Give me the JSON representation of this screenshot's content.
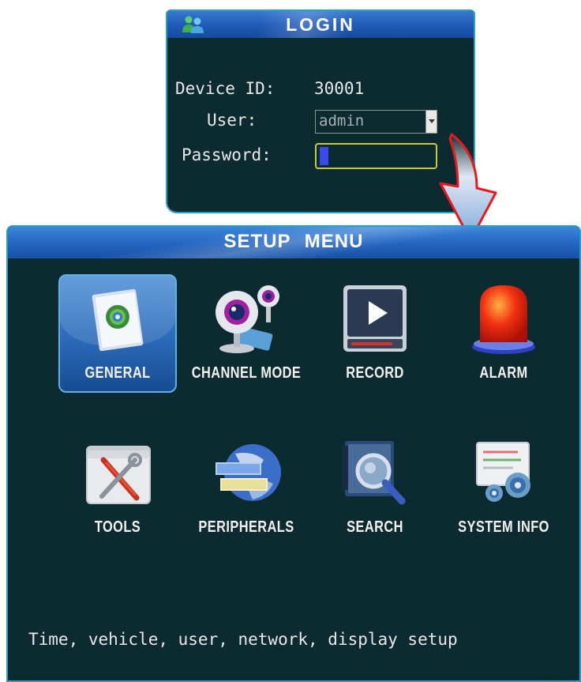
{
  "login": {
    "title": "LOGIN",
    "device_id_label": "Device ID:",
    "device_id_value": "30001",
    "user_label": "User:",
    "user_value": "admin",
    "password_label": "Password:"
  },
  "setup_menu": {
    "title": "SETUP MENU",
    "items": [
      {
        "label": "GENERAL",
        "icon": "general-settings-icon",
        "selected": true
      },
      {
        "label": "CHANNEL MODE",
        "icon": "webcam-icon",
        "selected": false
      },
      {
        "label": "RECORD",
        "icon": "play-record-icon",
        "selected": false
      },
      {
        "label": "ALARM",
        "icon": "alarm-siren-icon",
        "selected": false
      },
      {
        "label": "TOOLS",
        "icon": "tools-icon",
        "selected": false
      },
      {
        "label": "PERIPHERALS",
        "icon": "globe-peripherals-icon",
        "selected": false
      },
      {
        "label": "SEARCH",
        "icon": "magnifier-search-icon",
        "selected": false
      },
      {
        "label": "SYSTEM INFO",
        "icon": "system-info-gears-icon",
        "selected": false
      }
    ],
    "description": "Time, vehicle, user, network, display setup"
  },
  "colors": {
    "panel_bg": "#0c2b31",
    "title_bar": "#2264c0",
    "border": "#2a9fc4",
    "password_focus": "#c8c840",
    "cursor": "#3a48f0",
    "arrow": "#e8191e"
  }
}
